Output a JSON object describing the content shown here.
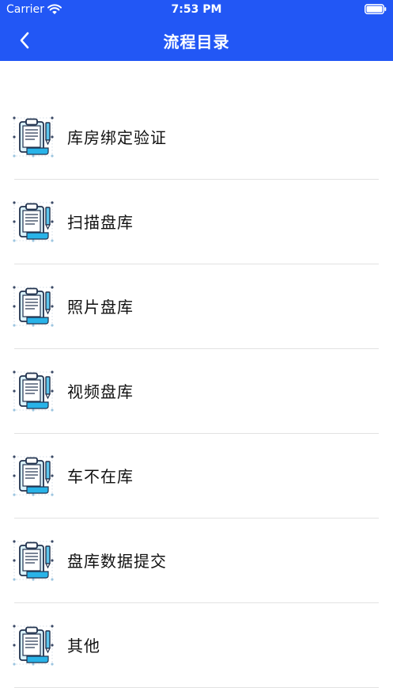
{
  "status_bar": {
    "carrier": "Carrier",
    "time": "7:53 PM"
  },
  "nav": {
    "title": "流程目录",
    "back_icon": "chevron-left-icon"
  },
  "colors": {
    "header_bg": "#2257f5",
    "icon_accent": "#29b3e8"
  },
  "items": [
    {
      "label": "库房绑定验证",
      "icon": "clipboard-icon"
    },
    {
      "label": "扫描盘库",
      "icon": "clipboard-icon"
    },
    {
      "label": "照片盘库",
      "icon": "clipboard-icon"
    },
    {
      "label": "视频盘库",
      "icon": "clipboard-icon"
    },
    {
      "label": "车不在库",
      "icon": "clipboard-icon"
    },
    {
      "label": "盘库数据提交",
      "icon": "clipboard-icon"
    },
    {
      "label": "其他",
      "icon": "clipboard-icon"
    }
  ]
}
